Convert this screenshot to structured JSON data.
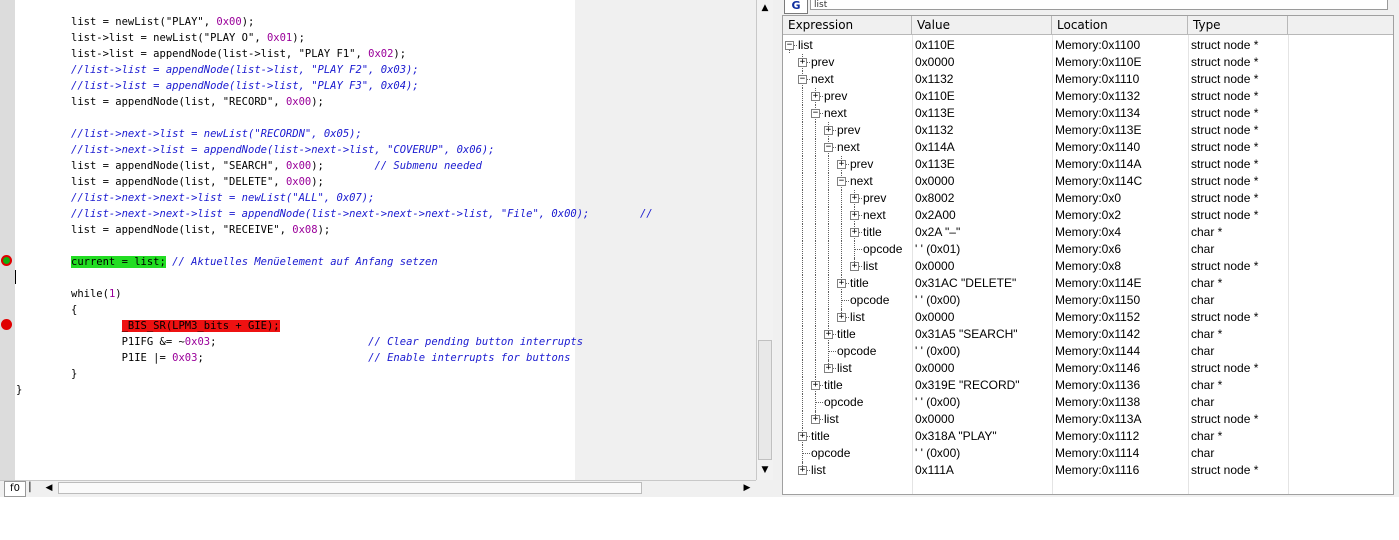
{
  "editor": {
    "lines": [
      [
        [
          "t",
          "list = newList(\"PLAY\", "
        ],
        [
          "n",
          "0x00"
        ],
        [
          "t",
          ");"
        ]
      ],
      [
        [
          "t",
          "list->list = newList(\"PLAY O\", "
        ],
        [
          "n",
          "0x01"
        ],
        [
          "t",
          ");"
        ]
      ],
      [
        [
          "t",
          "list->list = appendNode(list->list, \"PLAY F1\", "
        ],
        [
          "n",
          "0x02"
        ],
        [
          "t",
          ");"
        ]
      ],
      [
        [
          "c",
          "//list->list = appendNode(list->list, \"PLAY F2\", 0x03);"
        ]
      ],
      [
        [
          "c",
          "//list->list = appendNode(list->list, \"PLAY F3\", 0x04);"
        ]
      ],
      [
        [
          "t",
          "list = appendNode(list, \"RECORD\", "
        ],
        [
          "n",
          "0x00"
        ],
        [
          "t",
          ");"
        ]
      ],
      [],
      [
        [
          "c",
          "//list->next->list = newList(\"RECORDN\", 0x05);"
        ]
      ],
      [
        [
          "c",
          "//list->next->list = appendNode(list->next->list, \"COVERUP\", 0x06);"
        ]
      ],
      [
        [
          "t",
          "list = appendNode(list, \"SEARCH\", "
        ],
        [
          "n",
          "0x00"
        ],
        [
          "t",
          ");        "
        ],
        [
          "c",
          "// Submenu needed"
        ]
      ],
      [
        [
          "t",
          "list = appendNode(list, \"DELETE\", "
        ],
        [
          "n",
          "0x00"
        ],
        [
          "t",
          ");"
        ]
      ],
      [
        [
          "c",
          "//list->next->next->list = newList(\"ALL\", 0x07);"
        ]
      ],
      [
        [
          "c",
          "//list->next->next->list = appendNode(list->next->next->next->list, \"File\", 0x00);        //"
        ]
      ],
      [
        [
          "t",
          "list = appendNode(list, \"RECEIVE\", "
        ],
        [
          "n",
          "0x08"
        ],
        [
          "t",
          ");"
        ]
      ],
      [],
      [
        [
          "g",
          "current = list;"
        ],
        [
          "t",
          " "
        ],
        [
          "c",
          "// Aktuelles Menüelement auf Anfang setzen"
        ]
      ],
      [],
      [
        [
          "t",
          "while("
        ],
        [
          "n",
          "1"
        ],
        [
          "t",
          ")"
        ]
      ],
      [
        [
          "t",
          "{"
        ]
      ],
      [
        [
          "t",
          "        "
        ],
        [
          "r",
          "_BIS_SR(LPM3_bits + GIE);"
        ]
      ],
      [
        [
          "t",
          "        P1IFG &= ~"
        ],
        [
          "n",
          "0x03"
        ],
        [
          "t",
          ";                        "
        ],
        [
          "c",
          "// Clear pending button interrupts"
        ]
      ],
      [
        [
          "t",
          "        P1IE |= "
        ],
        [
          "n",
          "0x03"
        ],
        [
          "t",
          ";                          "
        ],
        [
          "c",
          "// Enable interrupts for buttons"
        ]
      ],
      [
        [
          "t",
          "}"
        ]
      ]
    ],
    "closing_brace": "}",
    "tab_label": "f0"
  },
  "watch": {
    "icon_label": "G",
    "expression_input": "list",
    "columns": [
      "Expression",
      "Value",
      "Location",
      "Type"
    ],
    "rows": [
      {
        "d": 0,
        "t": "-",
        "name": "list",
        "value": "0x110E",
        "location": "Memory:0x1100",
        "type": "struct node *"
      },
      {
        "d": 1,
        "t": "+",
        "name": "prev",
        "value": "0x0000",
        "location": "Memory:0x110E",
        "type": "struct node *"
      },
      {
        "d": 1,
        "t": "-",
        "name": "next",
        "value": "0x1132",
        "location": "Memory:0x1110",
        "type": "struct node *"
      },
      {
        "d": 2,
        "t": "+",
        "name": "prev",
        "value": "0x110E",
        "location": "Memory:0x1132",
        "type": "struct node *"
      },
      {
        "d": 2,
        "t": "-",
        "name": "next",
        "value": "0x113E",
        "location": "Memory:0x1134",
        "type": "struct node *"
      },
      {
        "d": 3,
        "t": "+",
        "name": "prev",
        "value": "0x1132",
        "location": "Memory:0x113E",
        "type": "struct node *"
      },
      {
        "d": 3,
        "t": "-",
        "name": "next",
        "value": "0x114A",
        "location": "Memory:0x1140",
        "type": "struct node *"
      },
      {
        "d": 4,
        "t": "+",
        "name": "prev",
        "value": "0x113E",
        "location": "Memory:0x114A",
        "type": "struct node *"
      },
      {
        "d": 4,
        "t": "-",
        "name": "next",
        "value": "0x0000",
        "location": "Memory:0x114C",
        "type": "struct node *"
      },
      {
        "d": 5,
        "t": "+",
        "name": "prev",
        "value": "0x8002",
        "location": "Memory:0x0",
        "type": "struct node *"
      },
      {
        "d": 5,
        "t": "+",
        "name": "next",
        "value": "0x2A00",
        "location": "Memory:0x2",
        "type": "struct node *"
      },
      {
        "d": 5,
        "t": "+",
        "name": "title",
        "value": "0x2A \"–\"",
        "location": "Memory:0x4",
        "type": "char *"
      },
      {
        "d": 5,
        "t": "",
        "name": "opcode",
        "value": "'   ' (0x01)",
        "location": "Memory:0x6",
        "type": "char"
      },
      {
        "d": 5,
        "t": "+",
        "name": "list",
        "value": "0x0000",
        "location": "Memory:0x8",
        "type": "struct node *"
      },
      {
        "d": 4,
        "t": "+",
        "name": "title",
        "value": "0x31AC \"DELETE\"",
        "location": "Memory:0x114E",
        "type": "char *"
      },
      {
        "d": 4,
        "t": "",
        "name": "opcode",
        "value": "'   ' (0x00)",
        "location": "Memory:0x1150",
        "type": "char"
      },
      {
        "d": 4,
        "t": "+",
        "name": "list",
        "value": "0x0000",
        "location": "Memory:0x1152",
        "type": "struct node *"
      },
      {
        "d": 3,
        "t": "+",
        "name": "title",
        "value": "0x31A5 \"SEARCH\"",
        "location": "Memory:0x1142",
        "type": "char *"
      },
      {
        "d": 3,
        "t": "",
        "name": "opcode",
        "value": "'   ' (0x00)",
        "location": "Memory:0x1144",
        "type": "char"
      },
      {
        "d": 3,
        "t": "+",
        "name": "list",
        "value": "0x0000",
        "location": "Memory:0x1146",
        "type": "struct node *"
      },
      {
        "d": 2,
        "t": "+",
        "name": "title",
        "value": "0x319E \"RECORD\"",
        "location": "Memory:0x1136",
        "type": "char *"
      },
      {
        "d": 2,
        "t": "",
        "name": "opcode",
        "value": "'   ' (0x00)",
        "location": "Memory:0x1138",
        "type": "char"
      },
      {
        "d": 2,
        "t": "+",
        "name": "list",
        "value": "0x0000",
        "location": "Memory:0x113A",
        "type": "struct node *"
      },
      {
        "d": 1,
        "t": "+",
        "name": "title",
        "value": "0x318A \"PLAY\"",
        "location": "Memory:0x1112",
        "type": "char *"
      },
      {
        "d": 1,
        "t": "",
        "name": "opcode",
        "value": "'   ' (0x00)",
        "location": "Memory:0x1114",
        "type": "char"
      },
      {
        "d": 1,
        "t": "+",
        "name": "list",
        "value": "0x111A",
        "location": "Memory:0x1116",
        "type": "struct node *"
      }
    ]
  }
}
